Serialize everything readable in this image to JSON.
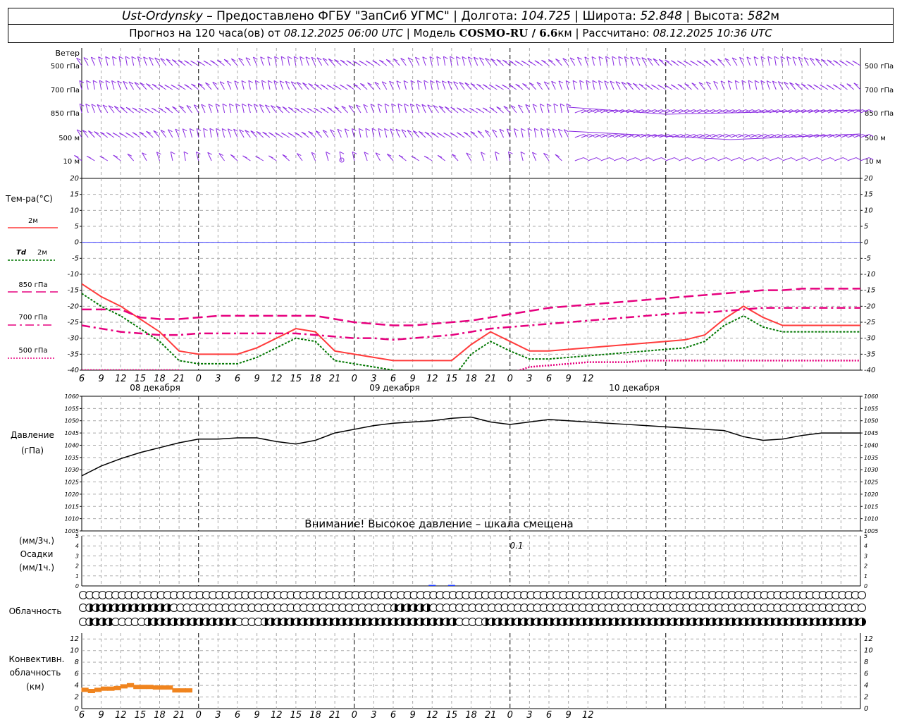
{
  "header": {
    "station": "Ust-Ordynsky",
    "provider": "– Предоставлено ФГБУ \"ЗапСиб УГМС\"",
    "lon_label": "Долгота:",
    "lon": "104.725",
    "lat_label": "Широта:",
    "lat": "52.848",
    "alt_label": "Высота:",
    "alt": "582",
    "alt_unit": "м",
    "forecast_label": "Прогноз на 120 часа(ов) от",
    "forecast_time": "08.12.2025 06:00 UTC",
    "model_label": "Модель",
    "model": "COSMO-RU / 6.6",
    "model_unit": "км",
    "calc_label": "Рассчитано:",
    "calc_time": "08.12.2025 10:36 UTC"
  },
  "labels": {
    "wind": "Ветер",
    "temp": "Тем-ра(°С)",
    "t2m": "2м",
    "td": "Td",
    "td2m": "2м",
    "t850": "850 гПа",
    "t700": "700 гПа",
    "t500": "500 гПа",
    "pressure": "Давление",
    "pressure_unit": "(гПа)",
    "precip_3h": "(мм/3ч.)",
    "precip": "Осадки",
    "precip_1h": "(мм/1ч.)",
    "cloud": "Облачность",
    "conv1": "Конвективн.",
    "conv2": "облачность",
    "conv3": "(км)",
    "warning": "Внимание! Высокое давление – шкала смещена",
    "precip_value": "0.1"
  },
  "colors": {
    "wind": "#8a2be2",
    "t2m": "#ff3b3b",
    "td": "#007700",
    "t850": "#e6007e",
    "zero": "#3a3aff",
    "pressure": "#000000",
    "precip": "#1e3cff",
    "conv": "#f0841e"
  },
  "chart_data": [
    {
      "type": "wind-barbs",
      "title": "Ветер",
      "levels": [
        "500 гПа",
        "700 гПа",
        "850 гПа",
        "500 м",
        "10  м"
      ]
    },
    {
      "type": "line",
      "title": "Тем-ра(°С)",
      "ylim": [
        -40,
        20
      ],
      "yticks": [
        -40,
        -35,
        -30,
        -25,
        -20,
        -15,
        -10,
        -5,
        0,
        5,
        10,
        15,
        20
      ],
      "xticks": [
        "6",
        "9",
        "12",
        "15",
        "18",
        "21",
        "0",
        "3",
        "6",
        "9",
        "12",
        "15",
        "18",
        "21",
        "0",
        "3",
        "6",
        "9",
        "12",
        "15",
        "18",
        "21",
        "0",
        "3",
        "6",
        "9",
        "12"
      ],
      "date_labels": [
        "08 декабря",
        "09 декабря",
        "10 декабря"
      ],
      "x": [
        0,
        3,
        6,
        9,
        12,
        15,
        18,
        21,
        24,
        27,
        33,
        36,
        39,
        42,
        45,
        48,
        51,
        54,
        57,
        60,
        63,
        66,
        69,
        72,
        75,
        78,
        81,
        84,
        87,
        90,
        93,
        96,
        99,
        102,
        105,
        108,
        111,
        114,
        117,
        120
      ],
      "series": [
        {
          "name": "2м",
          "values": [
            -13,
            -17,
            -20,
            -24,
            -28,
            -34,
            -35,
            -35,
            -35,
            -33,
            -27,
            -28,
            -34,
            -35,
            -36,
            -37,
            -37,
            -37,
            -37,
            -32,
            -28,
            -31,
            -34,
            -34,
            -33.5,
            -33,
            -32.5,
            -32,
            -31.5,
            -31,
            -30.5,
            -29,
            -24,
            -20,
            -23.5,
            -26,
            -26,
            -26,
            -26,
            -26
          ]
        },
        {
          "name": "Td 2м",
          "values": [
            -16,
            -20,
            -23,
            -27,
            -31,
            -37,
            -38,
            -38,
            -38,
            -36,
            -30,
            -31,
            -37,
            -38,
            -39,
            -40,
            -41,
            -42,
            -43,
            -35,
            -31,
            -34,
            -36.5,
            -36.5,
            -36,
            -35.5,
            -35,
            -34.5,
            -34,
            -33.5,
            -33,
            -31,
            -26,
            -23,
            -26.5,
            -28,
            -28,
            -28,
            -28,
            -28
          ]
        },
        {
          "name": "850 гПа",
          "values": [
            -21,
            -21,
            -21,
            -23.5,
            -24,
            -24,
            -23.5,
            -23,
            -23,
            -23,
            -23,
            -23,
            -24,
            -25,
            -25.5,
            -26,
            -26,
            -25.5,
            -25,
            -24.5,
            -23.5,
            -22.5,
            -21.5,
            -20.5,
            -20,
            -19.5,
            -19,
            -18.5,
            -18,
            -17.5,
            -17,
            -16.5,
            -16,
            -15.5,
            -15,
            -15,
            -14.5,
            -14.5,
            -14.5,
            -14.5
          ]
        },
        {
          "name": "700 гПа",
          "values": [
            -26,
            -27,
            -28,
            -28.5,
            -29,
            -29,
            -28.5,
            -28.5,
            -28.5,
            -28.5,
            -28.5,
            -29,
            -29.5,
            -30,
            -30,
            -30.5,
            -30,
            -29.5,
            -29,
            -28,
            -27,
            -26.5,
            -26,
            -25.5,
            -25,
            -24.5,
            -24,
            -23.5,
            -23,
            -22.5,
            -22,
            -22,
            -21.5,
            -21,
            -20.5,
            -20.5,
            -20.5,
            -20.5,
            -20.5,
            -20.5
          ]
        },
        {
          "name": "500 гПа",
          "values": [
            -40,
            -40,
            -40,
            -40,
            -40,
            -40,
            -41,
            -42,
            -43,
            -44,
            -44,
            -44,
            -44,
            -44,
            -45,
            -45,
            -45,
            -45,
            -45,
            -45,
            -42,
            -41,
            -39,
            -38.5,
            -38,
            -37.5,
            -37.5,
            -37.5,
            -37,
            -37,
            -37,
            -37,
            -37,
            -37,
            -37,
            -37,
            -37,
            -37,
            -37,
            -37
          ]
        }
      ]
    },
    {
      "type": "line",
      "title": "Давление",
      "ylabel": "(гПа)",
      "ylim": [
        1005,
        1060
      ],
      "yticks": [
        1005,
        1010,
        1015,
        1020,
        1025,
        1030,
        1035,
        1040,
        1045,
        1050,
        1055,
        1060
      ],
      "x": [
        0,
        3,
        6,
        9,
        12,
        15,
        18,
        21,
        24,
        27,
        30,
        33,
        36,
        39,
        42,
        45,
        48,
        51,
        54,
        57,
        60,
        63,
        66,
        69,
        72,
        75,
        78,
        81,
        84,
        87,
        90,
        93,
        96,
        99,
        102,
        105,
        108,
        111,
        114,
        117,
        120
      ],
      "series": [
        {
          "name": "Давление",
          "values": [
            1027.5,
            1031.5,
            1034.5,
            1037,
            1039,
            1041,
            1042.5,
            1042.5,
            1043,
            1043,
            1041.5,
            1040.5,
            1042,
            1045,
            1046.5,
            1048,
            1049,
            1049.5,
            1050,
            1051,
            1051.5,
            1049.5,
            1048.5,
            1049.5,
            1050.5,
            1050,
            1049.5,
            1049,
            1048.5,
            1048,
            1047.5,
            1047,
            1046.5,
            1046,
            1043.5,
            1042,
            1042.5,
            1044,
            1045,
            1045,
            1045
          ]
        }
      ]
    },
    {
      "type": "bar",
      "title": "Осадки",
      "ylim": [
        0,
        5
      ],
      "yticks": [
        0,
        1,
        2,
        3,
        4,
        5
      ],
      "annotation": "0.1",
      "x": [
        54,
        57
      ],
      "values": [
        0.1,
        0.1
      ]
    },
    {
      "type": "bar",
      "title": "Конвективн. облачность",
      "ylabel": "(км)",
      "ylim": [
        0,
        13
      ],
      "yticks": [
        0,
        2,
        4,
        6,
        8,
        10,
        12
      ],
      "x": [
        0,
        1,
        2,
        3,
        4,
        5,
        6,
        7,
        8,
        9,
        10,
        11,
        12,
        13,
        14,
        15,
        16
      ],
      "values": [
        3.6,
        3.4,
        3.6,
        3.8,
        3.8,
        3.9,
        4.2,
        4.4,
        4.1,
        4.1,
        4.1,
        4.0,
        4.0,
        4.0,
        3.5,
        3.5,
        3.5
      ]
    }
  ]
}
